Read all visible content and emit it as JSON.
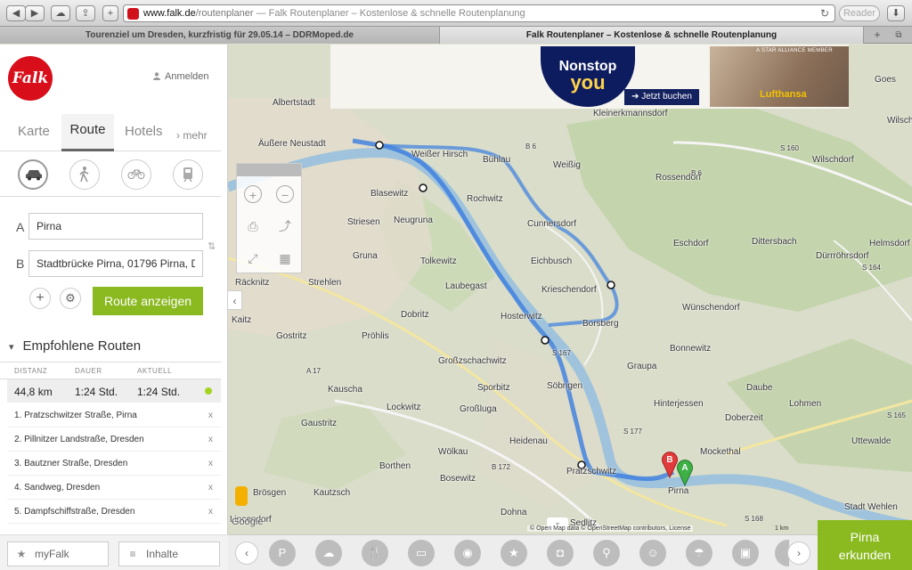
{
  "browser": {
    "url_host": "www.falk.de",
    "url_path": "/routenplaner",
    "page_title_suffix": " — Falk Routenplaner – Kostenlose & schnelle Routenplanung",
    "reader_label": "Reader",
    "tabs": [
      {
        "title": "Tourenziel um Dresden, kurzfristig für 29.05.14 – DDRMoped.de"
      },
      {
        "title": "Falk Routenplaner – Kostenlose & schnelle Routenplanung"
      }
    ]
  },
  "header": {
    "logo_text": "Falk",
    "login_label": "Anmelden"
  },
  "nav": {
    "tabs": [
      "Karte",
      "Route",
      "Hotels",
      "› mehr"
    ],
    "active": "Route"
  },
  "modes": [
    "car-icon",
    "walk-icon",
    "bicycle-icon",
    "train-icon"
  ],
  "route_form": {
    "from_label": "A",
    "from_value": "Pirna",
    "to_label": "B",
    "to_value": "Stadtbrücke Pirna, 01796 Pirna, Deutschland",
    "submit_label": "Route anzeigen"
  },
  "recommended": {
    "heading": "Empfohlene Routen",
    "columns": [
      "DISTANZ",
      "DAUER",
      "AKTUELL"
    ],
    "summary": {
      "distance": "44,8 km",
      "duration": "1:24 Std.",
      "current": "1:24 Std."
    },
    "steps": [
      {
        "text": "1.   Pratzschwitzer Straße, Pirna",
        "remove": "x"
      },
      {
        "text": "2.   Pillnitzer Landstraße, Dresden",
        "remove": "x"
      },
      {
        "text": "3.   Bautzner Straße, Dresden",
        "remove": "x"
      },
      {
        "text": "4.   Sandweg, Dresden",
        "remove": "x"
      },
      {
        "text": "5.   Dampfschiffstraße, Dresden",
        "remove": "x"
      }
    ]
  },
  "bottom_bar": {
    "myfalk": "myFalk",
    "inhalte": "Inhalte"
  },
  "ad": {
    "line1": "Nonstop",
    "line2": "you",
    "cta": "➔ Jetzt buchen",
    "brand": "Lufthansa",
    "tag": "A STAR ALLIANCE MEMBER"
  },
  "map": {
    "places": [
      {
        "name": "Albertstadt"
      },
      {
        "name": "Äußere Neustadt"
      },
      {
        "name": "Weißer Hirsch"
      },
      {
        "name": "Bühlau"
      },
      {
        "name": "Weißig"
      },
      {
        "name": "Rossendorf"
      },
      {
        "name": "Wilschdorf"
      },
      {
        "name": "Kleinerkmannsdorf"
      },
      {
        "name": "Blasewitz"
      },
      {
        "name": "Rochwitz"
      },
      {
        "name": "Striesen"
      },
      {
        "name": "Neugruna"
      },
      {
        "name": "Cunnersdorf"
      },
      {
        "name": "Eschdorf"
      },
      {
        "name": "Dittersbach"
      },
      {
        "name": "Helmsdorf"
      },
      {
        "name": "Dürrröhrsdorf"
      },
      {
        "name": "Gruna"
      },
      {
        "name": "Tolkewitz"
      },
      {
        "name": "Eichbusch"
      },
      {
        "name": "Räcknitz"
      },
      {
        "name": "Strehlen"
      },
      {
        "name": "Laubegast"
      },
      {
        "name": "Krieschendorf"
      },
      {
        "name": "Wünschendorf"
      },
      {
        "name": "Dobritz"
      },
      {
        "name": "Hosterwitz"
      },
      {
        "name": "Borsberg"
      },
      {
        "name": "Kaitz"
      },
      {
        "name": "Gostritz"
      },
      {
        "name": "Pröhlis"
      },
      {
        "name": "Bonnewitz"
      },
      {
        "name": "Großzschachwitz"
      },
      {
        "name": "Graupa"
      },
      {
        "name": "Kauscha"
      },
      {
        "name": "Sporbitz"
      },
      {
        "name": "Söbrigen"
      },
      {
        "name": "Daube"
      },
      {
        "name": "Lockwitz"
      },
      {
        "name": "Großluga"
      },
      {
        "name": "Hinterjessen"
      },
      {
        "name": "Doberzeit"
      },
      {
        "name": "Lohmen"
      },
      {
        "name": "Gaustritz"
      },
      {
        "name": "Heidenau"
      },
      {
        "name": "Uttewalde"
      },
      {
        "name": "Borthen"
      },
      {
        "name": "Wölkau"
      },
      {
        "name": "Pratzschwitz"
      },
      {
        "name": "Mockethal"
      },
      {
        "name": "Bosewitz"
      },
      {
        "name": "Pirna"
      },
      {
        "name": "Kautzsch"
      },
      {
        "name": "Brösgen"
      },
      {
        "name": "Dohna"
      },
      {
        "name": "Stadt Wehlen"
      },
      {
        "name": "Sedlitz"
      },
      {
        "name": "Lincendorf"
      },
      {
        "name": "Goes"
      },
      {
        "name": "Wilschdorf"
      }
    ],
    "roads": [
      "B 6",
      "B 6",
      "S 160",
      "S 164",
      "S 167",
      "S 177",
      "A 17",
      "B 172",
      "S 165",
      "S 168"
    ],
    "marker_a": "A",
    "marker_b": "B",
    "attribution": "© Open     Map data © OpenStreetMap contributors, License",
    "scale": "1 km",
    "logo": "Google"
  },
  "poi_bar": {
    "icons": [
      "parking-icon",
      "weather-icon",
      "restaurant-icon",
      "hotel-icon",
      "sightseeing-icon",
      "star-icon",
      "camera-icon",
      "bicycle-icon",
      "theater-icon",
      "beach-icon",
      "shopping-icon",
      "more-icon"
    ]
  },
  "explore": {
    "line1": "Pirna",
    "line2": "erkunden"
  }
}
